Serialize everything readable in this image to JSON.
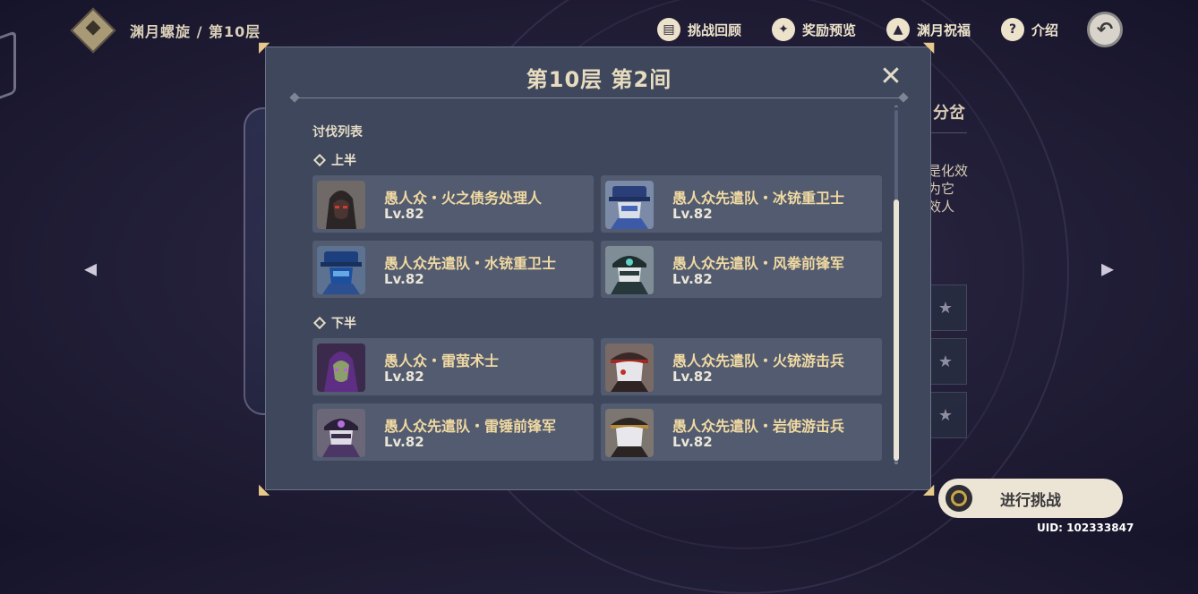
{
  "topbar": {
    "breadcrumb": "渊月螺旋 / 第10层",
    "buttons": [
      {
        "label": "挑战回顾",
        "icon": "book-icon"
      },
      {
        "label": "奖励预览",
        "icon": "star-badge-icon"
      },
      {
        "label": "渊月祝福",
        "icon": "up-arrow-icon"
      },
      {
        "label": "介绍",
        "icon": "question-icon"
      }
    ]
  },
  "background": {
    "peek_heading": "分岔",
    "peek_lines": [
      "是化效",
      "为它",
      "效人"
    ]
  },
  "modal": {
    "title": "第10层 第2间",
    "list_title": "讨伐列表",
    "sections": [
      {
        "label": "上半",
        "enemies": [
          {
            "name": "愚人众・火之债务处理人",
            "level": "Lv.82"
          },
          {
            "name": "愚人众先遣队・冰铳重卫士",
            "level": "Lv.82"
          },
          {
            "name": "愚人众先遣队・水铳重卫士",
            "level": "Lv.82"
          },
          {
            "name": "愚人众先遣队・风拳前锋军",
            "level": "Lv.82"
          }
        ]
      },
      {
        "label": "下半",
        "enemies": [
          {
            "name": "愚人众・雷萤术士",
            "level": "Lv.82"
          },
          {
            "name": "愚人众先遣队・火铳游击兵",
            "level": "Lv.82"
          },
          {
            "name": "愚人众先遣队・雷锤前锋军",
            "level": "Lv.82"
          },
          {
            "name": "愚人众先遣队・岩使游击兵",
            "level": "Lv.82"
          }
        ]
      }
    ]
  },
  "start_button": {
    "label": "进行挑战"
  },
  "uid": "UID: 102333847",
  "colors": {
    "accent_gold": "#f0d9a2",
    "modal_bg": "#3e475b",
    "card_bg": "#525b6f"
  }
}
